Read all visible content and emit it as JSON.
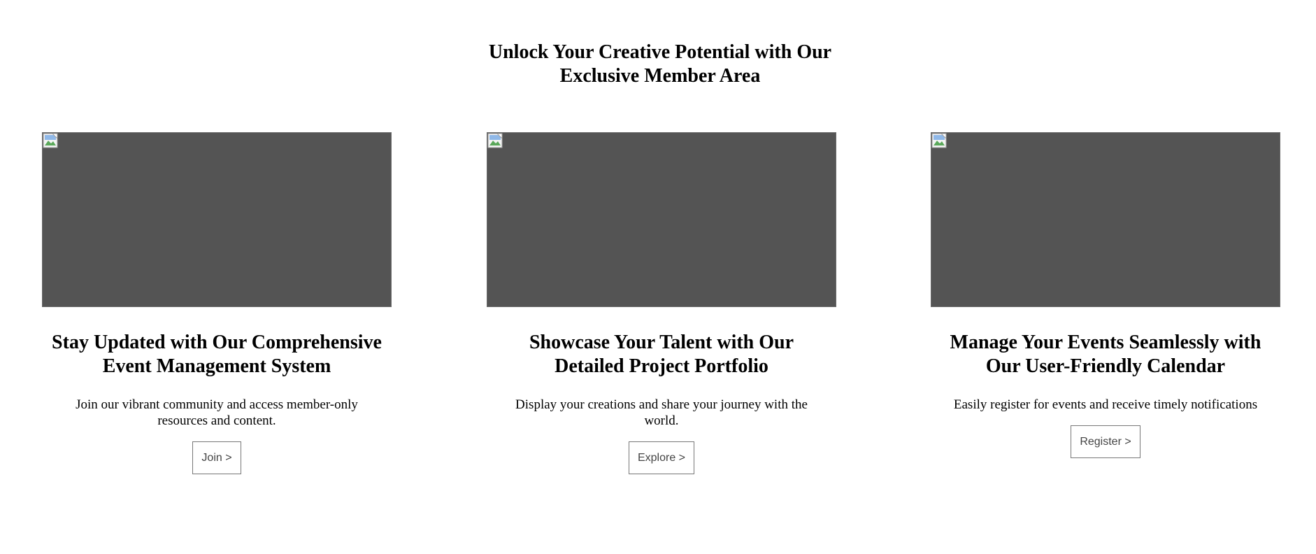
{
  "page": {
    "heading_line1": "Unlock Your Creative Potential with Our",
    "heading_line2": "Exclusive Member Area"
  },
  "colors": {
    "image_placeholder": "#545454",
    "button_border": "#777777",
    "button_text": "#444444"
  },
  "cards": [
    {
      "image_icon": "broken-image-icon",
      "title": "Stay Updated with Our Comprehensive Event Management System",
      "description": "Join our vibrant community and access member-only resources and content.",
      "button_label": "Join >"
    },
    {
      "image_icon": "broken-image-icon",
      "title": "Showcase Your Talent with Our Detailed Project Portfolio",
      "description": "Display your creations and share your journey with the world.",
      "button_label": "Explore >"
    },
    {
      "image_icon": "broken-image-icon",
      "title": "Manage Your Events Seamlessly with Our User-Friendly Calendar",
      "description": "Easily register for events and receive timely notifications",
      "button_label": "Register >"
    }
  ]
}
